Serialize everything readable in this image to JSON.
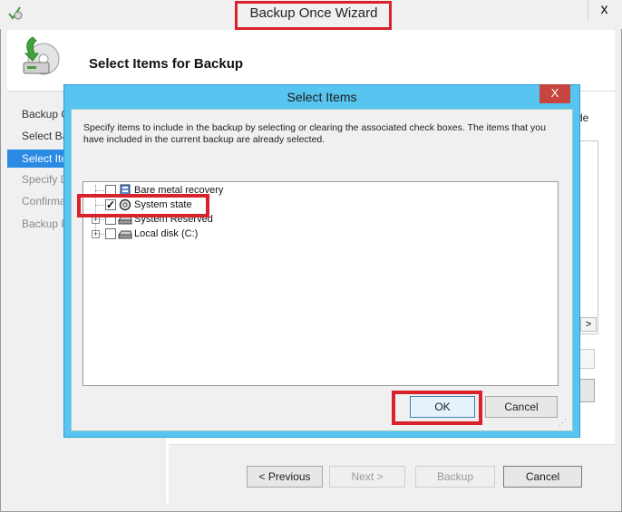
{
  "wizard": {
    "title": "Backup Once Wizard",
    "header_title": "Select Items for Backup",
    "close_glyph": "x",
    "nav_items": [
      {
        "label": "Backup Options",
        "state": "normal"
      },
      {
        "label": "Select Backup Configuration",
        "state": "normal"
      },
      {
        "label": "Select Items",
        "state": "selected"
      },
      {
        "label": "Specify Destination Type",
        "state": "disabled"
      },
      {
        "label": "Confirmation",
        "state": "disabled"
      },
      {
        "label": "Backup Progress",
        "state": "disabled"
      }
    ],
    "right_fragment_text": "de",
    "right_scroll_glyph": ">",
    "buttons": {
      "previous": "< Previous",
      "next": "Next >",
      "backup": "Backup",
      "cancel": "Cancel"
    }
  },
  "dialog": {
    "title": "Select Items",
    "close_glyph": "X",
    "instructions": "Specify items to include in the backup by selecting or clearing the associated check boxes. The items that you have included in the current backup are already selected.",
    "tree_items": [
      {
        "label": "Bare metal recovery",
        "checked": false,
        "expandable": false,
        "icon": "bare-metal-icon"
      },
      {
        "label": "System state",
        "checked": true,
        "expandable": false,
        "icon": "system-state-icon"
      },
      {
        "label": "System Reserved",
        "checked": false,
        "expandable": true,
        "icon": "drive-icon"
      },
      {
        "label": "Local disk (C:)",
        "checked": false,
        "expandable": true,
        "icon": "drive-icon"
      }
    ],
    "ok_label": "OK",
    "cancel_label": "Cancel",
    "grip_glyph": "⋰"
  },
  "colors": {
    "dialog_frame": "#57c5ef",
    "selected_nav": "#2a8ae4",
    "highlight": "#d9232c",
    "close_button": "#c7453e"
  }
}
